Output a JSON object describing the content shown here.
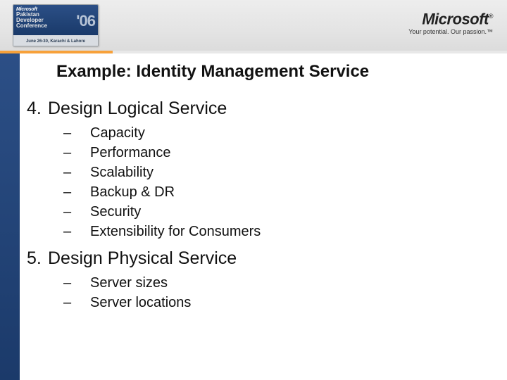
{
  "header": {
    "badge": {
      "ms": "Microsoft",
      "line1": "Pakistan",
      "line2": "Developer",
      "line3": "Conference",
      "year": "'06",
      "dateplace": "June 26-30, Karachi & Lahore"
    },
    "logo_text": "Microsoft",
    "logo_reg": "®",
    "tagline": "Your potential. Our passion.™"
  },
  "title": "Example: Identity Management Service",
  "sections": [
    {
      "num": "4.",
      "heading": "Design Logical Service",
      "items": [
        "Capacity",
        "Performance",
        "Scalability",
        "Backup & DR",
        "Security",
        "Extensibility for Consumers"
      ]
    },
    {
      "num": "5.",
      "heading": "Design Physical Service",
      "items": [
        "Server sizes",
        "Server locations"
      ]
    }
  ],
  "dash": "–"
}
